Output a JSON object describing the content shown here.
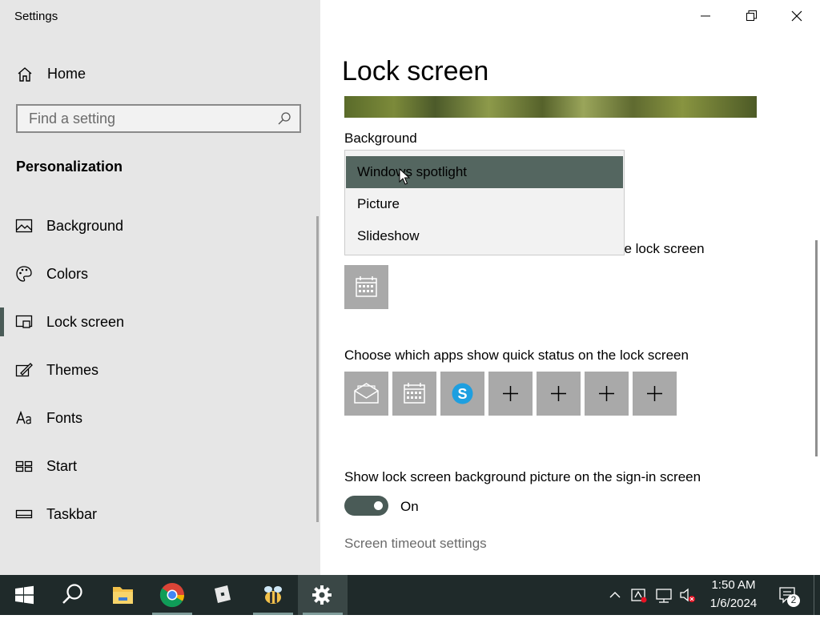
{
  "window": {
    "title": "Settings"
  },
  "sidebar": {
    "home_label": "Home",
    "search_placeholder": "Find a setting",
    "section_title": "Personalization",
    "items": [
      {
        "label": "Background",
        "icon": "picture-icon"
      },
      {
        "label": "Colors",
        "icon": "palette-icon"
      },
      {
        "label": "Lock screen",
        "icon": "lock-screen-icon",
        "active": true
      },
      {
        "label": "Themes",
        "icon": "brush-icon"
      },
      {
        "label": "Fonts",
        "icon": "fonts-icon"
      },
      {
        "label": "Start",
        "icon": "start-tiles-icon"
      },
      {
        "label": "Taskbar",
        "icon": "taskbar-icon"
      }
    ]
  },
  "main": {
    "page_title": "Lock screen",
    "background_label": "Background",
    "background_options": [
      "Windows spotlight",
      "Picture",
      "Slideshow"
    ],
    "background_selected": "Windows spotlight",
    "detailed_status_label_tail": "he lock screen",
    "quick_status_label": "Choose which apps show quick status on the lock screen",
    "signin_label": "Show lock screen background picture on the sign-in screen",
    "toggle_state": "On",
    "timeout_link": "Screen timeout settings"
  },
  "taskbar": {
    "time": "1:50 AM",
    "date": "1/6/2024",
    "notification_count": "2"
  },
  "colors": {
    "accent": "#4a5b57",
    "sidebar_bg": "#e6e6e6",
    "taskbar_bg": "#1f2a2a",
    "tile_bg": "#a9a9a9",
    "selected_option_bg": "#546660"
  }
}
